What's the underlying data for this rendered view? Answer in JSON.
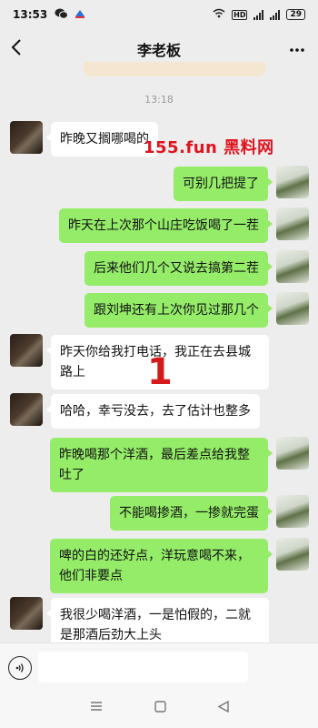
{
  "status_bar": {
    "time": "13:53",
    "battery": "29"
  },
  "chat": {
    "title": "李老板",
    "back_icon": "chevron-left-icon",
    "more_icon": "more-icon"
  },
  "timestamp": "13:18",
  "watermark": "155.fun 黑料网",
  "annotation_mark": "1",
  "messages": [
    {
      "side": "left",
      "text": "昨晚又搁哪喝的"
    },
    {
      "side": "right",
      "text": "可别几把提了"
    },
    {
      "side": "right",
      "text": "昨天在上次那个山庄吃饭喝了一茬"
    },
    {
      "side": "right",
      "text": "后来他们几个又说去搞第二茬"
    },
    {
      "side": "right",
      "text": "跟刘坤还有上次你见过那几个"
    },
    {
      "side": "left",
      "text": "昨天你给我打电话，我正在去县城路上"
    },
    {
      "side": "left",
      "text": "哈哈，幸亏没去，去了估计也整多"
    },
    {
      "side": "right",
      "text": "昨晚喝那个洋酒，最后差点给我整吐了"
    },
    {
      "side": "right",
      "text": "不能喝掺酒，一掺就完蛋"
    },
    {
      "side": "right",
      "text": "啤的白的还好点，洋玩意喝不来，他们非要点"
    },
    {
      "side": "left",
      "text": "我很少喝洋酒，一是怕假的，二就是那酒后劲大上头"
    }
  ],
  "input": {
    "voice_icon": "voice-icon",
    "placeholder": ""
  },
  "system_nav": {
    "menu_icon": "menu-icon",
    "home_icon": "home-icon",
    "back_icon": "back-triangle-icon"
  }
}
